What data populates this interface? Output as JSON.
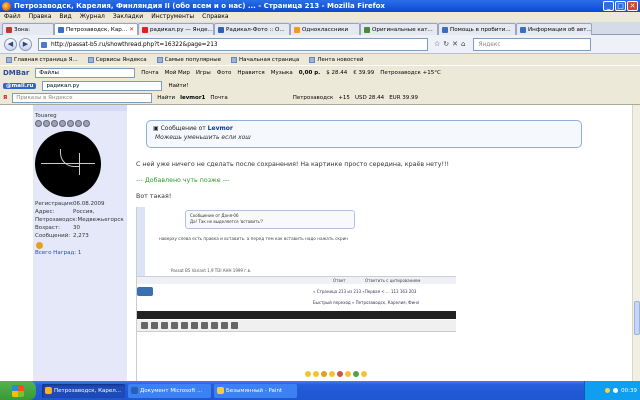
{
  "window": {
    "title": "Петрозаводск, Карелия, Финляндия II (обо всем и о нас) ... - Страница 213 - Mozilla Firefox",
    "buttons": [
      "_",
      "□",
      "✕"
    ]
  },
  "menu": [
    "Файл",
    "Правка",
    "Вид",
    "Журнал",
    "Закладки",
    "Инструменты",
    "Справка"
  ],
  "tabs": [
    {
      "label": "Зона:",
      "active": false
    },
    {
      "label": "Петрозаводск, Кар...",
      "active": true
    },
    {
      "label": "радикал.ру — Янде...",
      "active": false
    },
    {
      "label": "Радикал-Фото :: О...",
      "active": false
    },
    {
      "label": "Одноклассники",
      "active": false
    },
    {
      "label": "Оригинальные кат...",
      "active": false
    },
    {
      "label": "Помощь в пробити...",
      "active": false
    },
    {
      "label": "Информация об авт...",
      "active": false
    }
  ],
  "nav": {
    "url": "http://passat-b5.ru/showthread.php?t=16322&page=213",
    "search_placeholder": "Яндекс"
  },
  "bookmarks": [
    "Главная страница Я...",
    "Сервисы Яндекса",
    "Самые популярные",
    "Начальная страница",
    "Лента новостей"
  ],
  "toolbar1": {
    "brand": "DMBar",
    "field": "Файлы",
    "items": [
      "Почта",
      "Мой Мир",
      "Игры",
      "Фото",
      "Нравится",
      "Музыка"
    ],
    "values": [
      "0,00 р.",
      "$ 28.44",
      "€ 39.99"
    ],
    "weather": "Петрозаводск +15°C"
  },
  "toolbar2": {
    "brand": "@mail.ru",
    "field": "радикал.ру",
    "find": "Найти!"
  },
  "toolbar3": {
    "search_placeholder": "Приказы в Яндексе",
    "find": "Найти",
    "user": "levmor1",
    "mail": "Почта",
    "city": "Петрозаводск",
    "temp": "+15",
    "usd": "USD 28.44",
    "eur": "EUR 39.99"
  },
  "user": {
    "name": "Touareg",
    "info": [
      {
        "k": "Регистрация:",
        "v": "06.08.2009"
      },
      {
        "k": "Адрес:",
        "v": "Россия,"
      },
      {
        "k": "Петрозаводск:",
        "v": "Медвежьегорск"
      },
      {
        "k": "Возраст:",
        "v": "30"
      },
      {
        "k": "Сообщений:",
        "v": "2,273"
      }
    ],
    "thanks": "Всего Наград: 1"
  },
  "quote": {
    "header": "Сообщение от",
    "author": "Levmor",
    "text": "Можешь уменьшить если хош"
  },
  "post": {
    "line1": "С ней уже ничего не сделать после сохранения! На картинке просто середина, краёв нету!!!",
    "added": "--- Добавлено чуть позже ---",
    "line2": "Вот такая!"
  },
  "shot": {
    "quote_header": "Сообщение от Даня-06",
    "quote_text": "Да! Так не выделяется 'вставить'?",
    "text": "наверху слева есть правка и вставить. а перед тем как вставить надо нажать скрин",
    "sign": "Passat B5 Variant 1,9 TDI AHH 1999 г.в.",
    "btn_reply": "Ответ",
    "btn_quote": "Ответить с цитированием",
    "pager": "« Страница 213 из 213  «Первая  <  ...  113  163  203",
    "jump": "Быстрый переход  « Петрозаводск, Карелия, Финл"
  },
  "taskbar": {
    "items": [
      {
        "label": "Петрозаводск, Карел...",
        "active": true
      },
      {
        "label": "Документ Microsoft ...",
        "active": false
      },
      {
        "label": "Безымянный - Paint",
        "active": false
      }
    ],
    "clock": "00:39"
  }
}
